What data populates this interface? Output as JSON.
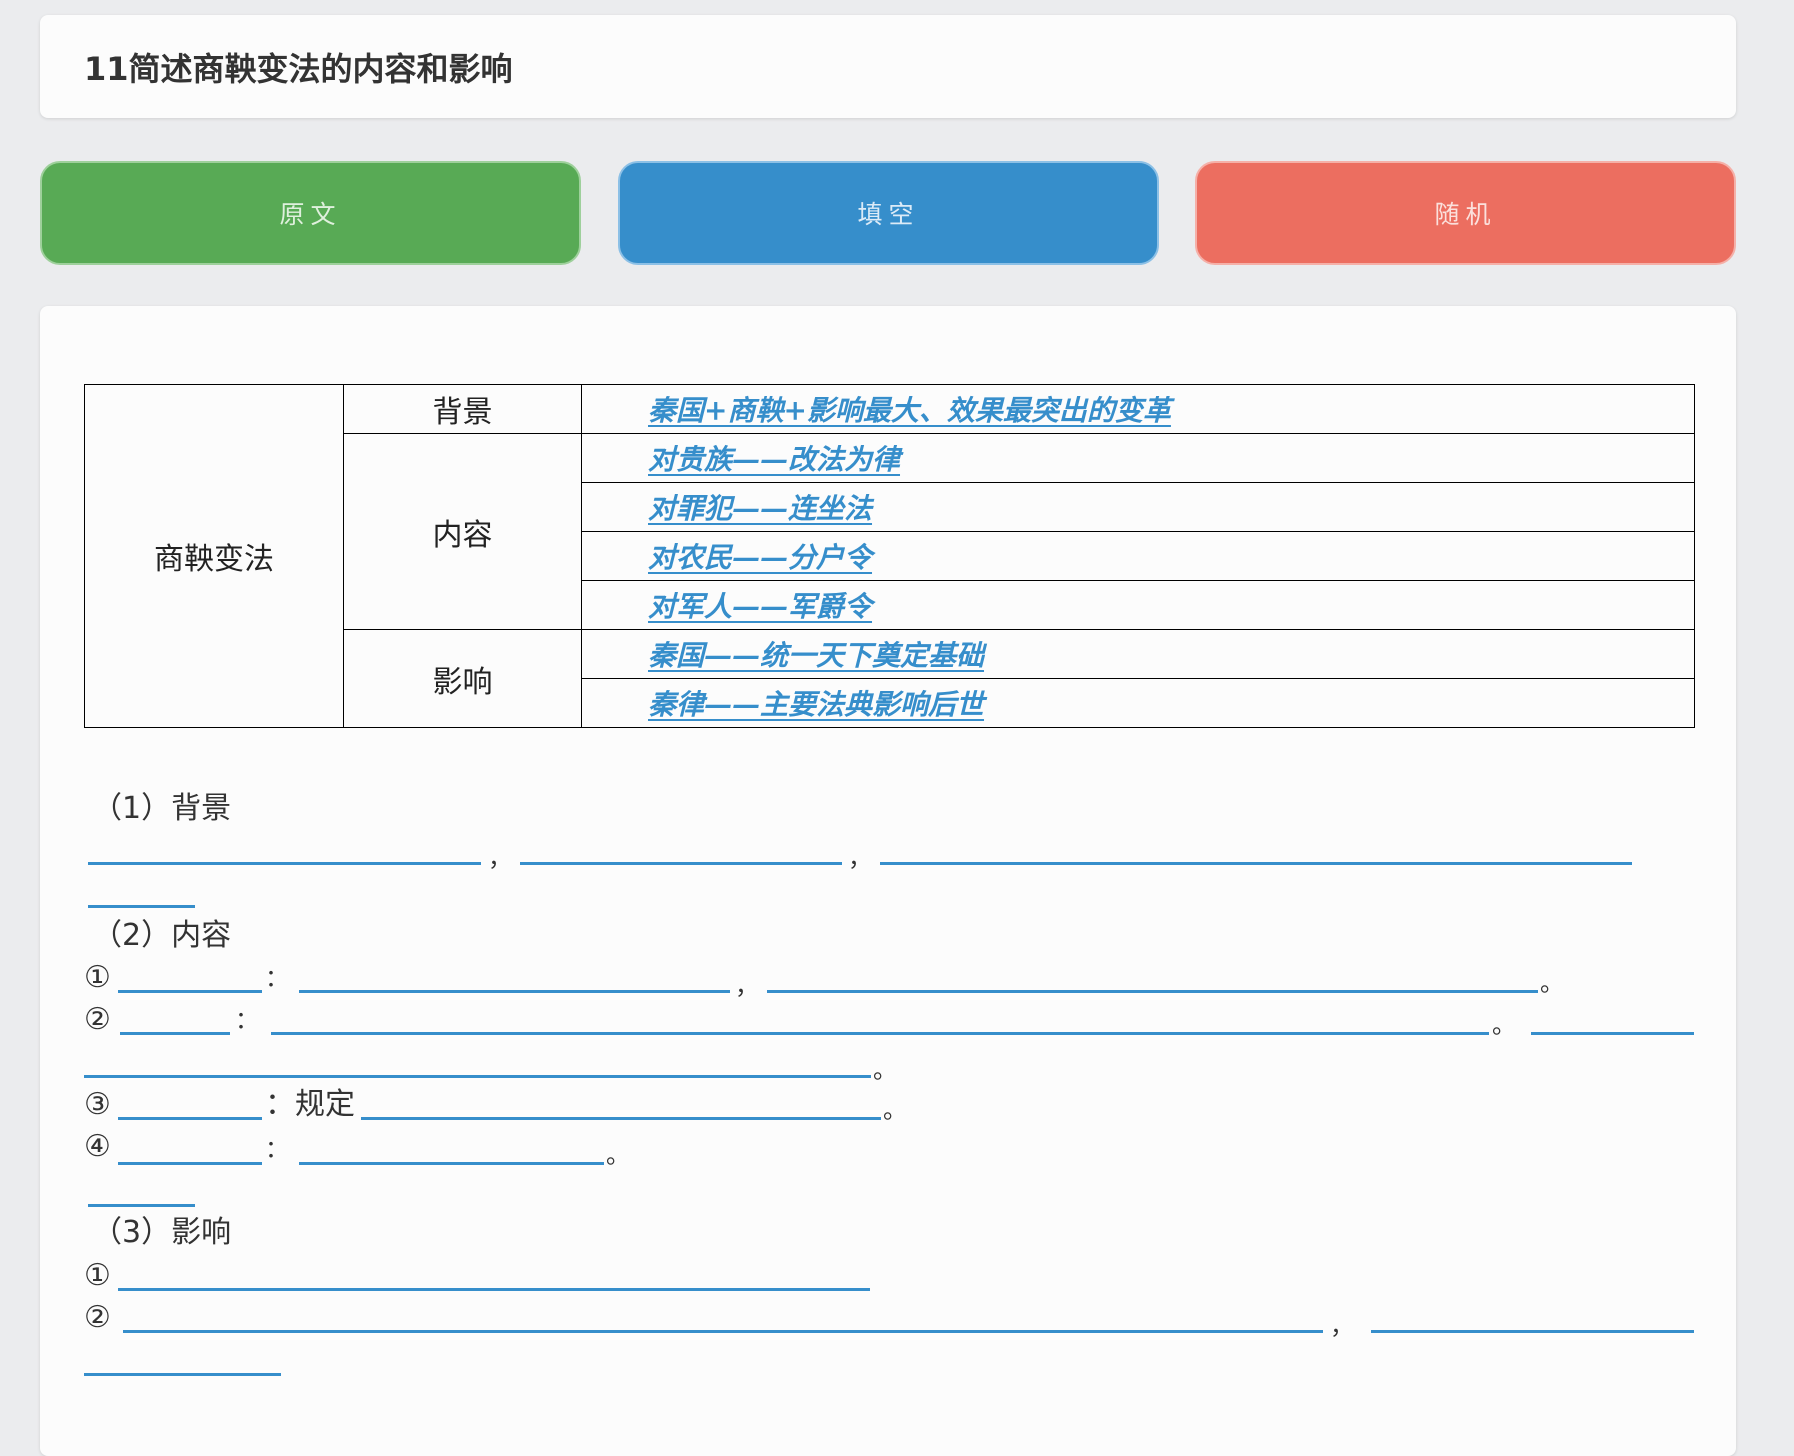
{
  "title": "11简述商鞅变法的内容和影响",
  "buttons": {
    "original": "原文",
    "fill": "填空",
    "random": "随机"
  },
  "colors": {
    "green": "#58aa55",
    "blue": "#368ecb",
    "red": "#ec6e60",
    "answer": "#368ecb"
  },
  "table": {
    "topic": "商鞅变法",
    "sections": {
      "background": "背景",
      "content": "内容",
      "impact": "影响"
    },
    "answers": [
      "秦国+商鞅+影响最大、效果最突出的变革",
      "对贵族——改法为律",
      "对罪犯——连坐法",
      "对农民——分户令",
      "对军人——军爵令",
      "秦国——统一天下奠定基础",
      "秦律——主要法典影响后世"
    ]
  },
  "exercise": {
    "h1": "（1）背景",
    "h2": "（2）内容",
    "h3": "（3）影响",
    "n1": "①",
    "n2": "②",
    "n3": "③",
    "n4": "④",
    "comma": "，",
    "colon": "：",
    "period": "。",
    "rule": "：规定"
  }
}
